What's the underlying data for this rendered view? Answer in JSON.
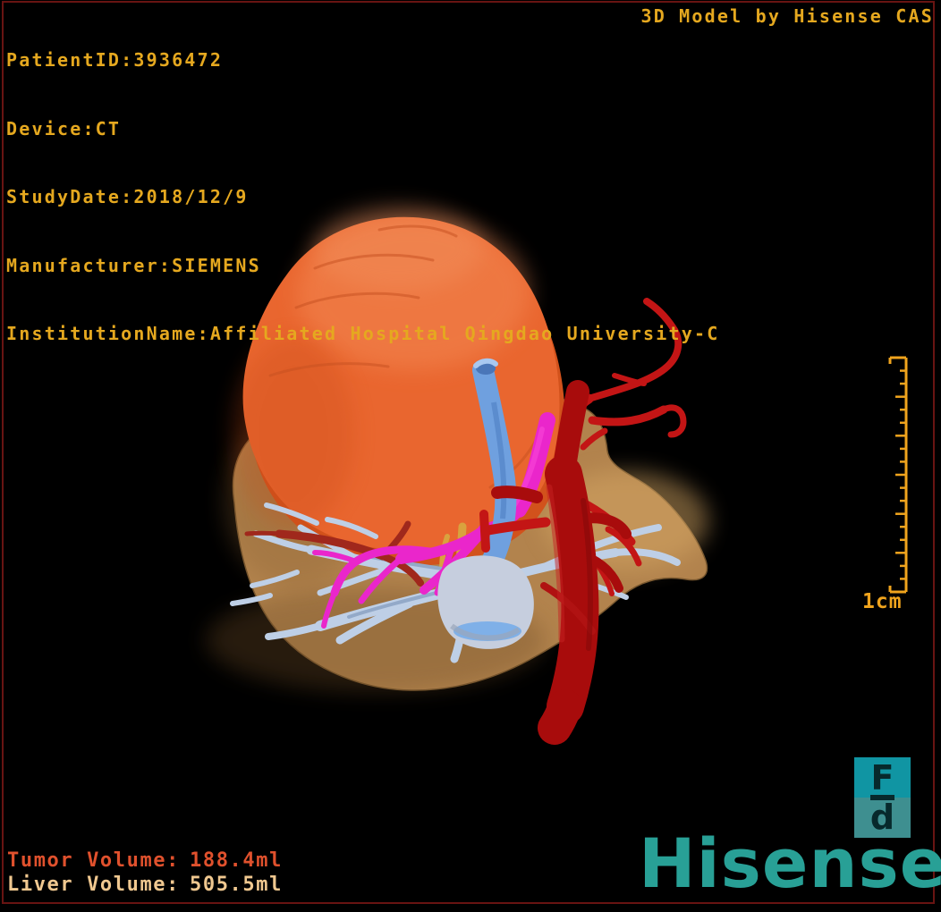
{
  "header": {
    "lines": [
      "PatientID:3936472",
      "Device:CT",
      "StudyDate:2018/12/9",
      "Manufacturer:SIEMENS",
      "InstitutionName:Affiliated Hospital Qingdao University-C"
    ],
    "watermark": "3D Model by Hisense CAS"
  },
  "volumes": {
    "tumor": {
      "label": "Tumor Volume:",
      "value": "188.4ml"
    },
    "liver": {
      "label": "Liver Volume:",
      "value": "505.5ml"
    }
  },
  "scale": {
    "label": "1cm"
  },
  "branding": {
    "badge_top": "F",
    "badge_bottom": "d",
    "wordmark": "Hisense"
  },
  "colors": {
    "background": "#000000",
    "frame_red": "#681412",
    "annotation_gold": "#e5a81f",
    "ruler_gold": "#f0a41d",
    "tumor_text": "#e0512d",
    "liver_text": "#f0c890",
    "brand_teal": "#28a096",
    "logo_teal_top": "#1095a3",
    "logo_teal_bottom": "#3e8f90",
    "tumor_orange": "#e9662f",
    "tumor_fold": "#d2521c",
    "liver_tan": "#ba8951",
    "portal_blue": "#6fa0df",
    "hepatic_vein_blue": "#becfe6",
    "artery_red": "#c31515",
    "vessel_dark_red": "#a80c0c",
    "magenta_vessel": "#ea26cb",
    "bile_gold": "#d9a23e"
  }
}
